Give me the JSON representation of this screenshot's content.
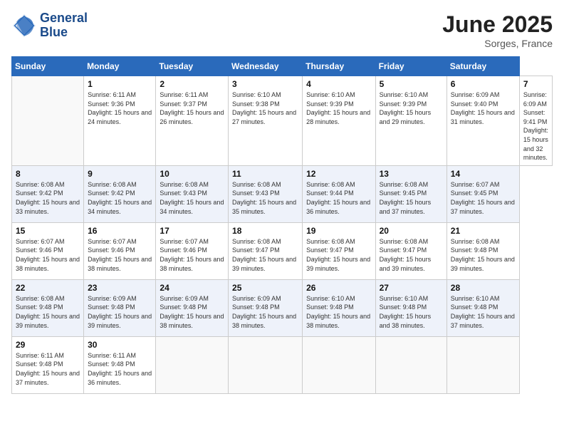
{
  "header": {
    "logo_line1": "General",
    "logo_line2": "Blue",
    "month_title": "June 2025",
    "location": "Sorges, France"
  },
  "weekdays": [
    "Sunday",
    "Monday",
    "Tuesday",
    "Wednesday",
    "Thursday",
    "Friday",
    "Saturday"
  ],
  "days": [
    {
      "day": "",
      "sunrise": "",
      "sunset": "",
      "daylight": ""
    },
    {
      "day": "1",
      "sunrise": "Sunrise: 6:11 AM",
      "sunset": "Sunset: 9:36 PM",
      "daylight": "Daylight: 15 hours and 24 minutes."
    },
    {
      "day": "2",
      "sunrise": "Sunrise: 6:11 AM",
      "sunset": "Sunset: 9:37 PM",
      "daylight": "Daylight: 15 hours and 26 minutes."
    },
    {
      "day": "3",
      "sunrise": "Sunrise: 6:10 AM",
      "sunset": "Sunset: 9:38 PM",
      "daylight": "Daylight: 15 hours and 27 minutes."
    },
    {
      "day": "4",
      "sunrise": "Sunrise: 6:10 AM",
      "sunset": "Sunset: 9:39 PM",
      "daylight": "Daylight: 15 hours and 28 minutes."
    },
    {
      "day": "5",
      "sunrise": "Sunrise: 6:10 AM",
      "sunset": "Sunset: 9:39 PM",
      "daylight": "Daylight: 15 hours and 29 minutes."
    },
    {
      "day": "6",
      "sunrise": "Sunrise: 6:09 AM",
      "sunset": "Sunset: 9:40 PM",
      "daylight": "Daylight: 15 hours and 31 minutes."
    },
    {
      "day": "7",
      "sunrise": "Sunrise: 6:09 AM",
      "sunset": "Sunset: 9:41 PM",
      "daylight": "Daylight: 15 hours and 32 minutes."
    },
    {
      "day": "8",
      "sunrise": "Sunrise: 6:08 AM",
      "sunset": "Sunset: 9:42 PM",
      "daylight": "Daylight: 15 hours and 33 minutes."
    },
    {
      "day": "9",
      "sunrise": "Sunrise: 6:08 AM",
      "sunset": "Sunset: 9:42 PM",
      "daylight": "Daylight: 15 hours and 34 minutes."
    },
    {
      "day": "10",
      "sunrise": "Sunrise: 6:08 AM",
      "sunset": "Sunset: 9:43 PM",
      "daylight": "Daylight: 15 hours and 34 minutes."
    },
    {
      "day": "11",
      "sunrise": "Sunrise: 6:08 AM",
      "sunset": "Sunset: 9:43 PM",
      "daylight": "Daylight: 15 hours and 35 minutes."
    },
    {
      "day": "12",
      "sunrise": "Sunrise: 6:08 AM",
      "sunset": "Sunset: 9:44 PM",
      "daylight": "Daylight: 15 hours and 36 minutes."
    },
    {
      "day": "13",
      "sunrise": "Sunrise: 6:08 AM",
      "sunset": "Sunset: 9:45 PM",
      "daylight": "Daylight: 15 hours and 37 minutes."
    },
    {
      "day": "14",
      "sunrise": "Sunrise: 6:07 AM",
      "sunset": "Sunset: 9:45 PM",
      "daylight": "Daylight: 15 hours and 37 minutes."
    },
    {
      "day": "15",
      "sunrise": "Sunrise: 6:07 AM",
      "sunset": "Sunset: 9:46 PM",
      "daylight": "Daylight: 15 hours and 38 minutes."
    },
    {
      "day": "16",
      "sunrise": "Sunrise: 6:07 AM",
      "sunset": "Sunset: 9:46 PM",
      "daylight": "Daylight: 15 hours and 38 minutes."
    },
    {
      "day": "17",
      "sunrise": "Sunrise: 6:07 AM",
      "sunset": "Sunset: 9:46 PM",
      "daylight": "Daylight: 15 hours and 38 minutes."
    },
    {
      "day": "18",
      "sunrise": "Sunrise: 6:08 AM",
      "sunset": "Sunset: 9:47 PM",
      "daylight": "Daylight: 15 hours and 39 minutes."
    },
    {
      "day": "19",
      "sunrise": "Sunrise: 6:08 AM",
      "sunset": "Sunset: 9:47 PM",
      "daylight": "Daylight: 15 hours and 39 minutes."
    },
    {
      "day": "20",
      "sunrise": "Sunrise: 6:08 AM",
      "sunset": "Sunset: 9:47 PM",
      "daylight": "Daylight: 15 hours and 39 minutes."
    },
    {
      "day": "21",
      "sunrise": "Sunrise: 6:08 AM",
      "sunset": "Sunset: 9:48 PM",
      "daylight": "Daylight: 15 hours and 39 minutes."
    },
    {
      "day": "22",
      "sunrise": "Sunrise: 6:08 AM",
      "sunset": "Sunset: 9:48 PM",
      "daylight": "Daylight: 15 hours and 39 minutes."
    },
    {
      "day": "23",
      "sunrise": "Sunrise: 6:09 AM",
      "sunset": "Sunset: 9:48 PM",
      "daylight": "Daylight: 15 hours and 39 minutes."
    },
    {
      "day": "24",
      "sunrise": "Sunrise: 6:09 AM",
      "sunset": "Sunset: 9:48 PM",
      "daylight": "Daylight: 15 hours and 38 minutes."
    },
    {
      "day": "25",
      "sunrise": "Sunrise: 6:09 AM",
      "sunset": "Sunset: 9:48 PM",
      "daylight": "Daylight: 15 hours and 38 minutes."
    },
    {
      "day": "26",
      "sunrise": "Sunrise: 6:10 AM",
      "sunset": "Sunset: 9:48 PM",
      "daylight": "Daylight: 15 hours and 38 minutes."
    },
    {
      "day": "27",
      "sunrise": "Sunrise: 6:10 AM",
      "sunset": "Sunset: 9:48 PM",
      "daylight": "Daylight: 15 hours and 38 minutes."
    },
    {
      "day": "28",
      "sunrise": "Sunrise: 6:10 AM",
      "sunset": "Sunset: 9:48 PM",
      "daylight": "Daylight: 15 hours and 37 minutes."
    },
    {
      "day": "29",
      "sunrise": "Sunrise: 6:11 AM",
      "sunset": "Sunset: 9:48 PM",
      "daylight": "Daylight: 15 hours and 37 minutes."
    },
    {
      "day": "30",
      "sunrise": "Sunrise: 6:11 AM",
      "sunset": "Sunset: 9:48 PM",
      "daylight": "Daylight: 15 hours and 36 minutes."
    },
    {
      "day": "",
      "sunrise": "",
      "sunset": "",
      "daylight": ""
    },
    {
      "day": "",
      "sunrise": "",
      "sunset": "",
      "daylight": ""
    },
    {
      "day": "",
      "sunrise": "",
      "sunset": "",
      "daylight": ""
    },
    {
      "day": "",
      "sunrise": "",
      "sunset": "",
      "daylight": ""
    },
    {
      "day": "",
      "sunrise": "",
      "sunset": "",
      "daylight": ""
    }
  ]
}
